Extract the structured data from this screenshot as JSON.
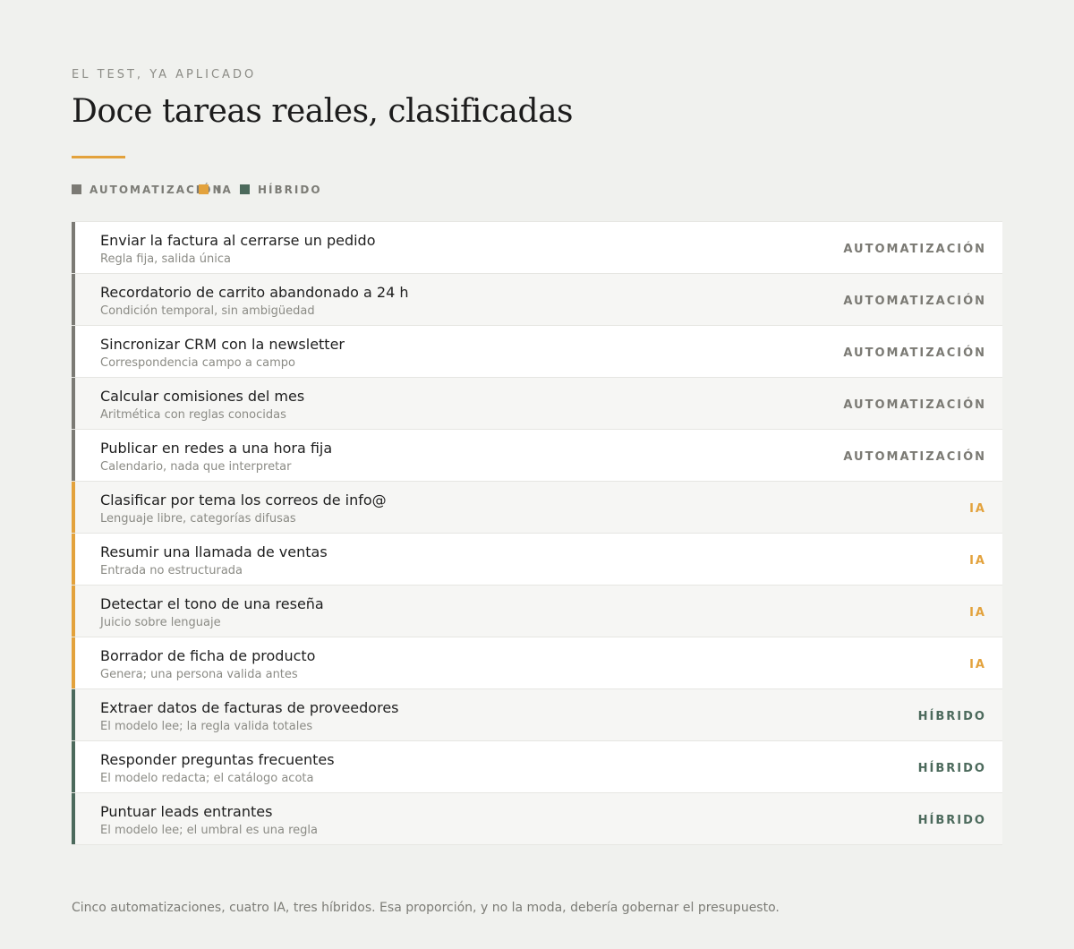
{
  "header": {
    "eyebrow": "EL TEST, YA APLICADO",
    "title": "Doce tareas reales, clasificadas"
  },
  "colors": {
    "automation": "#7b7a74",
    "ai": "#e3a23c",
    "hybrid": "#4c6a5c",
    "accent_rule": "#e3a23c"
  },
  "legend": [
    {
      "label": "AUTOMATIZACIÓN",
      "kind": "automation"
    },
    {
      "label": "IA",
      "kind": "ai"
    },
    {
      "label": "HÍBRIDO",
      "kind": "hybrid"
    }
  ],
  "tasks": [
    {
      "title": "Enviar la factura al cerrarse un pedido",
      "subtitle": "Regla fija, salida única",
      "tag": "AUTOMATIZACIÓN",
      "kind": "automation"
    },
    {
      "title": "Recordatorio de carrito abandonado a 24 h",
      "subtitle": "Condición temporal, sin ambigüedad",
      "tag": "AUTOMATIZACIÓN",
      "kind": "automation"
    },
    {
      "title": "Sincronizar CRM con la newsletter",
      "subtitle": "Correspondencia campo a campo",
      "tag": "AUTOMATIZACIÓN",
      "kind": "automation"
    },
    {
      "title": "Calcular comisiones del mes",
      "subtitle": "Aritmética con reglas conocidas",
      "tag": "AUTOMATIZACIÓN",
      "kind": "automation"
    },
    {
      "title": "Publicar en redes a una hora fija",
      "subtitle": "Calendario, nada que interpretar",
      "tag": "AUTOMATIZACIÓN",
      "kind": "automation"
    },
    {
      "title": "Clasificar por tema los correos de info@",
      "subtitle": "Lenguaje libre, categorías difusas",
      "tag": "IA",
      "kind": "ai"
    },
    {
      "title": "Resumir una llamada de ventas",
      "subtitle": "Entrada no estructurada",
      "tag": "IA",
      "kind": "ai"
    },
    {
      "title": "Detectar el tono de una reseña",
      "subtitle": "Juicio sobre lenguaje",
      "tag": "IA",
      "kind": "ai"
    },
    {
      "title": "Borrador de ficha de producto",
      "subtitle": "Genera; una persona valida antes",
      "tag": "IA",
      "kind": "ai"
    },
    {
      "title": "Extraer datos de facturas de proveedores",
      "subtitle": "El modelo lee; la regla valida totales",
      "tag": "HÍBRIDO",
      "kind": "hybrid"
    },
    {
      "title": "Responder preguntas frecuentes",
      "subtitle": "El modelo redacta; el catálogo acota",
      "tag": "HÍBRIDO",
      "kind": "hybrid"
    },
    {
      "title": "Puntuar leads entrantes",
      "subtitle": "El modelo lee; el umbral es una regla",
      "tag": "HÍBRIDO",
      "kind": "hybrid"
    }
  ],
  "footer": "Cinco automatizaciones, cuatro IA, tres híbridos. Esa proporción, y no la moda, debería gobernar el presupuesto."
}
